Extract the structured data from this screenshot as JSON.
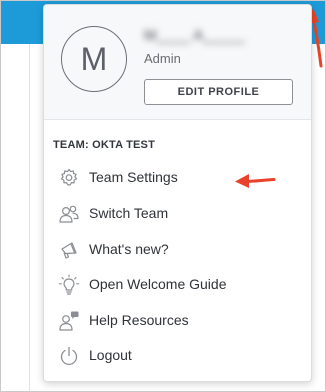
{
  "profile": {
    "avatar_initial": "M",
    "name": "M____ A_____",
    "role": "Admin",
    "edit_button": "EDIT PROFILE"
  },
  "team_label": "TEAM: OKTA TEST",
  "menu": {
    "items": [
      {
        "label": "Team Settings",
        "icon": "gear-icon"
      },
      {
        "label": "Switch Team",
        "icon": "users-icon"
      },
      {
        "label": "What's new?",
        "icon": "megaphone-icon"
      },
      {
        "label": "Open Welcome Guide",
        "icon": "lightbulb-icon"
      },
      {
        "label": "Help Resources",
        "icon": "help-user-icon"
      },
      {
        "label": "Logout",
        "icon": "power-icon"
      }
    ]
  },
  "colors": {
    "header_blue": "#1d9bd8",
    "annotation_red": "#e8432a",
    "text": "#2f3338",
    "icon_gray": "#8a8e93"
  }
}
